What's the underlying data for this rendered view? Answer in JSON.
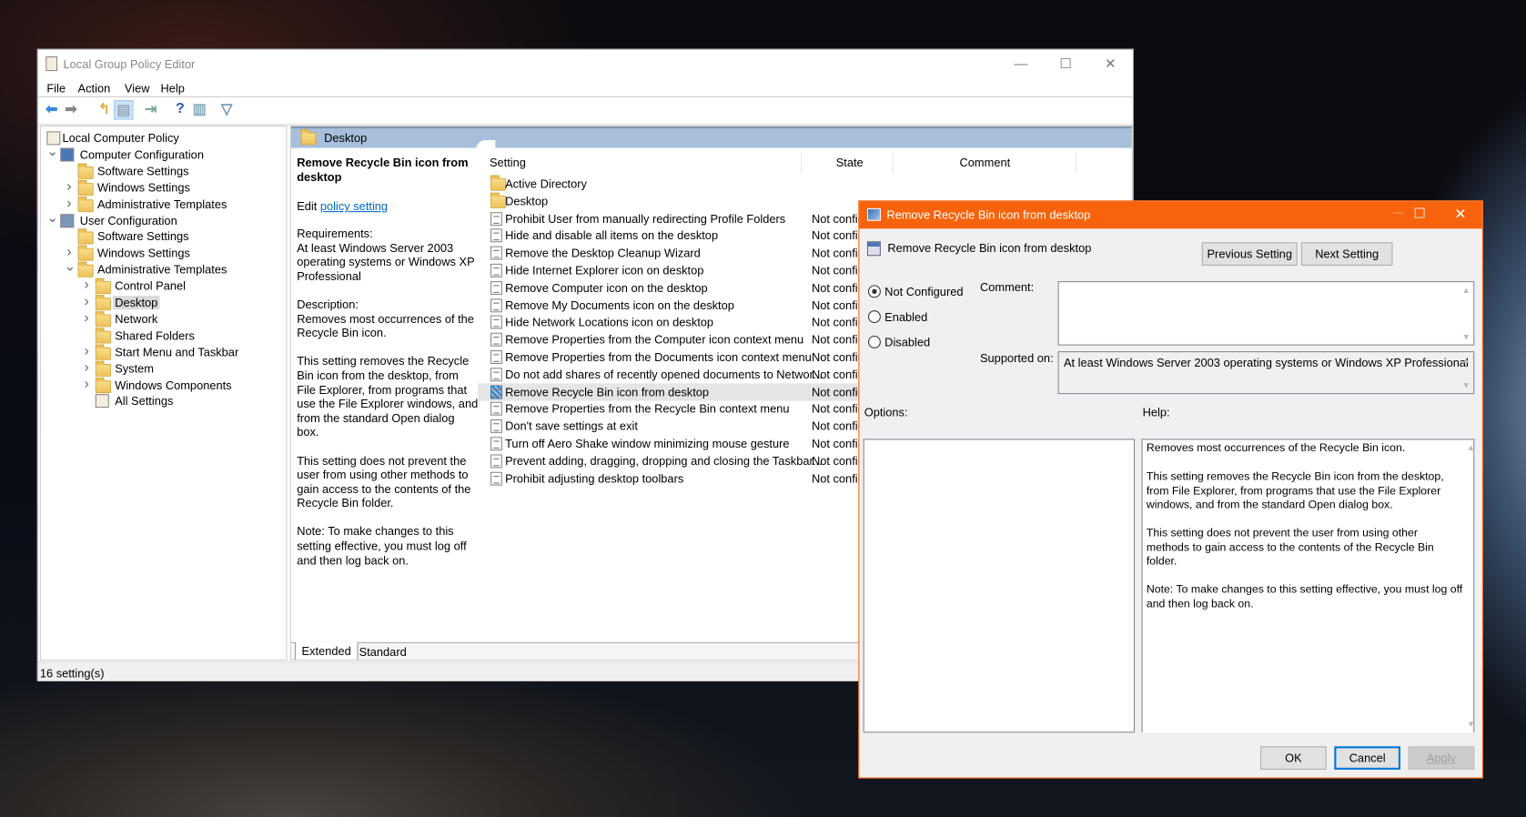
{
  "main_window": {
    "title": "Local Group Policy Editor",
    "menu": [
      "File",
      "Action",
      "View",
      "Help"
    ],
    "toolbar_icons": [
      "back-icon",
      "forward-icon",
      "up-folder-icon",
      "show-hide-tree-icon",
      "export-list-icon",
      "help-icon",
      "properties-pane-icon",
      "filter-icon"
    ],
    "tree": [
      {
        "label": "Local Computer Policy",
        "level": 0,
        "icon": "policy",
        "chevron": ""
      },
      {
        "label": "Computer Configuration",
        "level": 1,
        "icon": "computer",
        "chevron": "down"
      },
      {
        "label": "Software Settings",
        "level": 2,
        "icon": "folder",
        "chevron": ""
      },
      {
        "label": "Windows Settings",
        "level": 2,
        "icon": "folder",
        "chevron": "right"
      },
      {
        "label": "Administrative Templates",
        "level": 2,
        "icon": "folder",
        "chevron": "right"
      },
      {
        "label": "User Configuration",
        "level": 1,
        "icon": "user",
        "chevron": "down"
      },
      {
        "label": "Software Settings",
        "level": 2,
        "icon": "folder",
        "chevron": ""
      },
      {
        "label": "Windows Settings",
        "level": 2,
        "icon": "folder",
        "chevron": "right"
      },
      {
        "label": "Administrative Templates",
        "level": 2,
        "icon": "folder",
        "chevron": "down"
      },
      {
        "label": "Control Panel",
        "level": 3,
        "icon": "folder",
        "chevron": "right"
      },
      {
        "label": "Desktop",
        "level": 3,
        "icon": "folder",
        "chevron": "right",
        "selected": true
      },
      {
        "label": "Network",
        "level": 3,
        "icon": "folder",
        "chevron": "right"
      },
      {
        "label": "Shared Folders",
        "level": 3,
        "icon": "folder",
        "chevron": ""
      },
      {
        "label": "Start Menu and Taskbar",
        "level": 3,
        "icon": "folder",
        "chevron": "right"
      },
      {
        "label": "System",
        "level": 3,
        "icon": "folder",
        "chevron": "right"
      },
      {
        "label": "Windows Components",
        "level": 3,
        "icon": "folder",
        "chevron": "right"
      },
      {
        "label": "All Settings",
        "level": 3,
        "icon": "all-settings",
        "chevron": ""
      }
    ],
    "pane_header": "Desktop",
    "description": {
      "title": "Remove Recycle Bin icon from desktop",
      "edit_prefix": "Edit ",
      "edit_link": "policy setting ",
      "body": "Requirements:\nAt least Windows Server 2003 operating systems or Windows XP Professional\n\nDescription:\nRemoves most occurrences of the Recycle Bin icon.\n\nThis setting removes the Recycle Bin icon from the desktop, from File Explorer, from programs that use the File Explorer windows, and from the standard Open dialog box.\n\nThis setting does not prevent the user from using other methods to gain access to the contents of the Recycle Bin folder.\n\nNote: To make changes to this setting effective, you must log off and then log back on."
    },
    "columns": [
      "Setting",
      "State",
      "Comment"
    ],
    "rows": [
      {
        "name": "Active Directory",
        "state": "",
        "type": "folder"
      },
      {
        "name": "Desktop",
        "state": "",
        "type": "folder"
      },
      {
        "name": "Prohibit User from manually redirecting Profile Folders",
        "state": "Not config",
        "type": "policy"
      },
      {
        "name": "Hide and disable all items on the desktop",
        "state": "Not config",
        "type": "policy"
      },
      {
        "name": "Remove the Desktop Cleanup Wizard",
        "state": "Not config",
        "type": "policy"
      },
      {
        "name": "Hide Internet Explorer icon on desktop",
        "state": "Not config",
        "type": "policy"
      },
      {
        "name": "Remove Computer icon on the desktop",
        "state": "Not config",
        "type": "policy"
      },
      {
        "name": "Remove My Documents icon on the desktop",
        "state": "Not config",
        "type": "policy"
      },
      {
        "name": "Hide Network Locations icon on desktop",
        "state": "Not config",
        "type": "policy"
      },
      {
        "name": "Remove Properties from the Computer icon context menu",
        "state": "Not config",
        "type": "policy"
      },
      {
        "name": "Remove Properties from the Documents icon context menu",
        "state": "Not config",
        "type": "policy"
      },
      {
        "name": "Do not add shares of recently opened documents to Networ...",
        "state": "Not config",
        "type": "policy"
      },
      {
        "name": "Remove Recycle Bin icon from desktop",
        "state": "Not config",
        "type": "policy",
        "selected": true
      },
      {
        "name": "Remove Properties from the Recycle Bin context menu",
        "state": "Not config",
        "type": "policy"
      },
      {
        "name": "Don't save settings at exit",
        "state": "Not config",
        "type": "policy"
      },
      {
        "name": "Turn off Aero Shake window minimizing mouse gesture",
        "state": "Not config",
        "type": "policy"
      },
      {
        "name": "Prevent adding, dragging, dropping and closing the Taskbar...",
        "state": "Not config",
        "type": "policy"
      },
      {
        "name": "Prohibit adjusting desktop toolbars",
        "state": "Not config",
        "type": "policy"
      }
    ],
    "tabs": [
      "Extended",
      "Standard"
    ],
    "status": "16 setting(s)"
  },
  "dialog": {
    "title": "Remove Recycle Bin icon from desktop",
    "setting_name": "Remove Recycle Bin icon from desktop",
    "prev_button": "Previous Setting",
    "next_button": "Next Setting",
    "radios": [
      {
        "label": "Not Configured",
        "checked": true
      },
      {
        "label": "Enabled",
        "checked": false
      },
      {
        "label": "Disabled",
        "checked": false
      }
    ],
    "comment_label": "Comment:",
    "comment_value": "",
    "supported_label": "Supported on:",
    "supported_value": "At least Windows Server 2003 operating systems or Windows XP Professional",
    "options_label": "Options:",
    "help_label": "Help:",
    "help_text": "Removes most occurrences of the Recycle Bin icon.\n\nThis setting removes the Recycle Bin icon from the desktop, from File Explorer, from programs that use the File Explorer windows, and from the standard Open dialog box.\n\nThis setting does not prevent the user from using other methods to gain access to the contents of the Recycle Bin folder.\n\nNote: To make changes to this setting effective, you must log off and then log back on.",
    "ok": "OK",
    "cancel": "Cancel",
    "apply": "Apply"
  },
  "colors": {
    "accent": "#f7630c",
    "header": "#a7bfdb",
    "link": "#0066cc"
  }
}
